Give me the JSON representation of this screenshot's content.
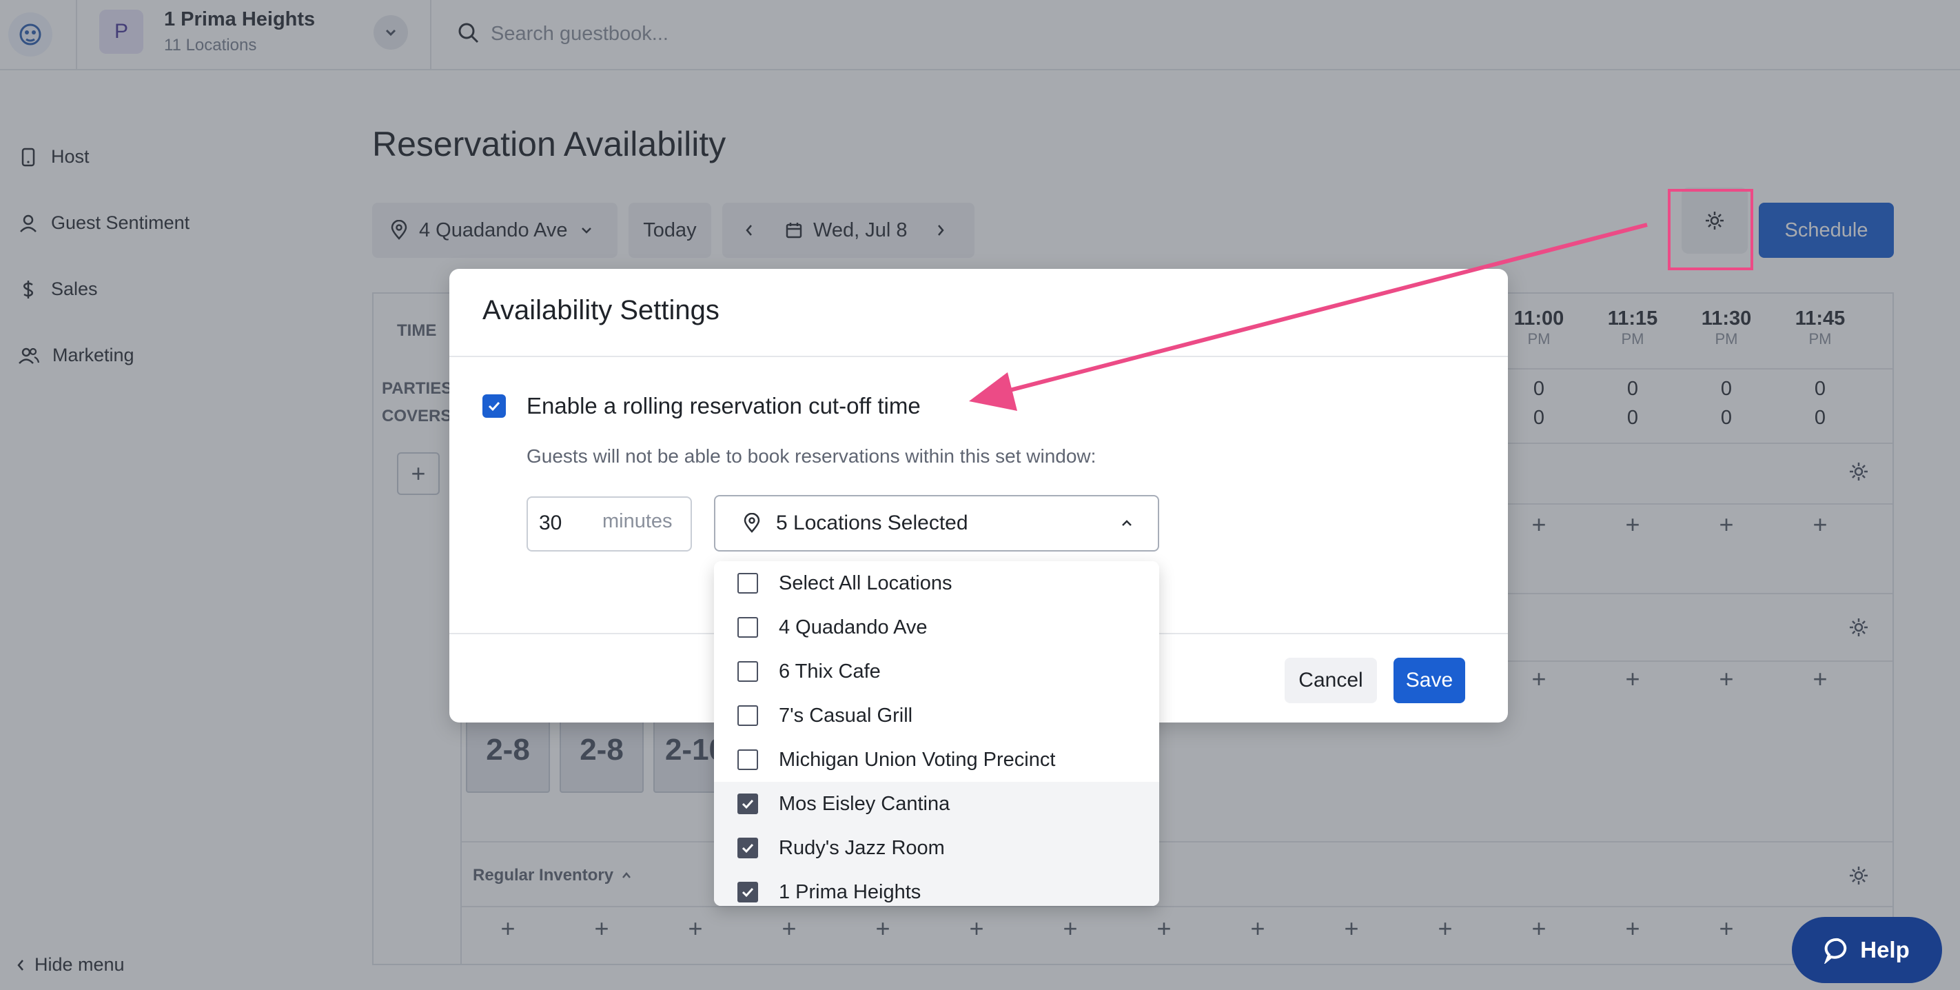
{
  "topbar": {
    "location_initial": "P",
    "location_name": "1 Prima Heights",
    "location_count": "11 Locations",
    "search_placeholder": "Search guestbook..."
  },
  "sidebar": {
    "items": [
      {
        "label": "Host",
        "icon": "tablet-icon"
      },
      {
        "label": "Guest Sentiment",
        "icon": "user-icon"
      },
      {
        "label": "Sales",
        "icon": "dollar-icon"
      },
      {
        "label": "Marketing",
        "icon": "users-icon"
      }
    ],
    "hide_menu": "Hide menu"
  },
  "main": {
    "title": "Reservation Availability",
    "location_select": "4 Quadando Ave",
    "today_label": "Today",
    "date_label": "Wed, Jul 8",
    "schedule_label": "Schedule"
  },
  "grid": {
    "time_label": "TIME",
    "parties_label": "PARTIES",
    "covers_label": "COVERS",
    "times": [
      {
        "t": "11:00",
        "p": "PM"
      },
      {
        "t": "11:15",
        "p": "PM"
      },
      {
        "t": "11:30",
        "p": "PM"
      },
      {
        "t": "11:45",
        "p": "PM"
      }
    ],
    "parties": [
      "0",
      "0",
      "0",
      "0"
    ],
    "covers": [
      "0",
      "0",
      "0",
      "0"
    ],
    "blocks": [
      "2-8",
      "2-8",
      "2-10"
    ],
    "regular_inventory_label": "Regular Inventory",
    "add_symbol": "+"
  },
  "modal": {
    "title": "Availability Settings",
    "enable_label": "Enable a rolling reservation cut-off time",
    "enable_checked": true,
    "help_text": "Guests will not be able to book reservations within this set window:",
    "minutes_value": "30",
    "minutes_unit": "minutes",
    "locations_selected": "5 Locations Selected",
    "cancel_label": "Cancel",
    "save_label": "Save"
  },
  "dropdown": {
    "options": [
      {
        "label": "Select All Locations",
        "checked": false
      },
      {
        "label": "4 Quadando Ave",
        "checked": false
      },
      {
        "label": "6 Thix Cafe",
        "checked": false
      },
      {
        "label": "7's Casual Grill",
        "checked": false
      },
      {
        "label": "Michigan Union Voting Precinct",
        "checked": false
      },
      {
        "label": "Mos Eisley Cantina",
        "checked": true
      },
      {
        "label": "Rudy's Jazz Room",
        "checked": true
      },
      {
        "label": "1 Prima Heights",
        "checked": true
      }
    ]
  },
  "help_button": {
    "label": "Help"
  },
  "colors": {
    "primary": "#1b5fd1",
    "annotation": "#ec4b86",
    "help_bg": "#1b3f8a"
  }
}
